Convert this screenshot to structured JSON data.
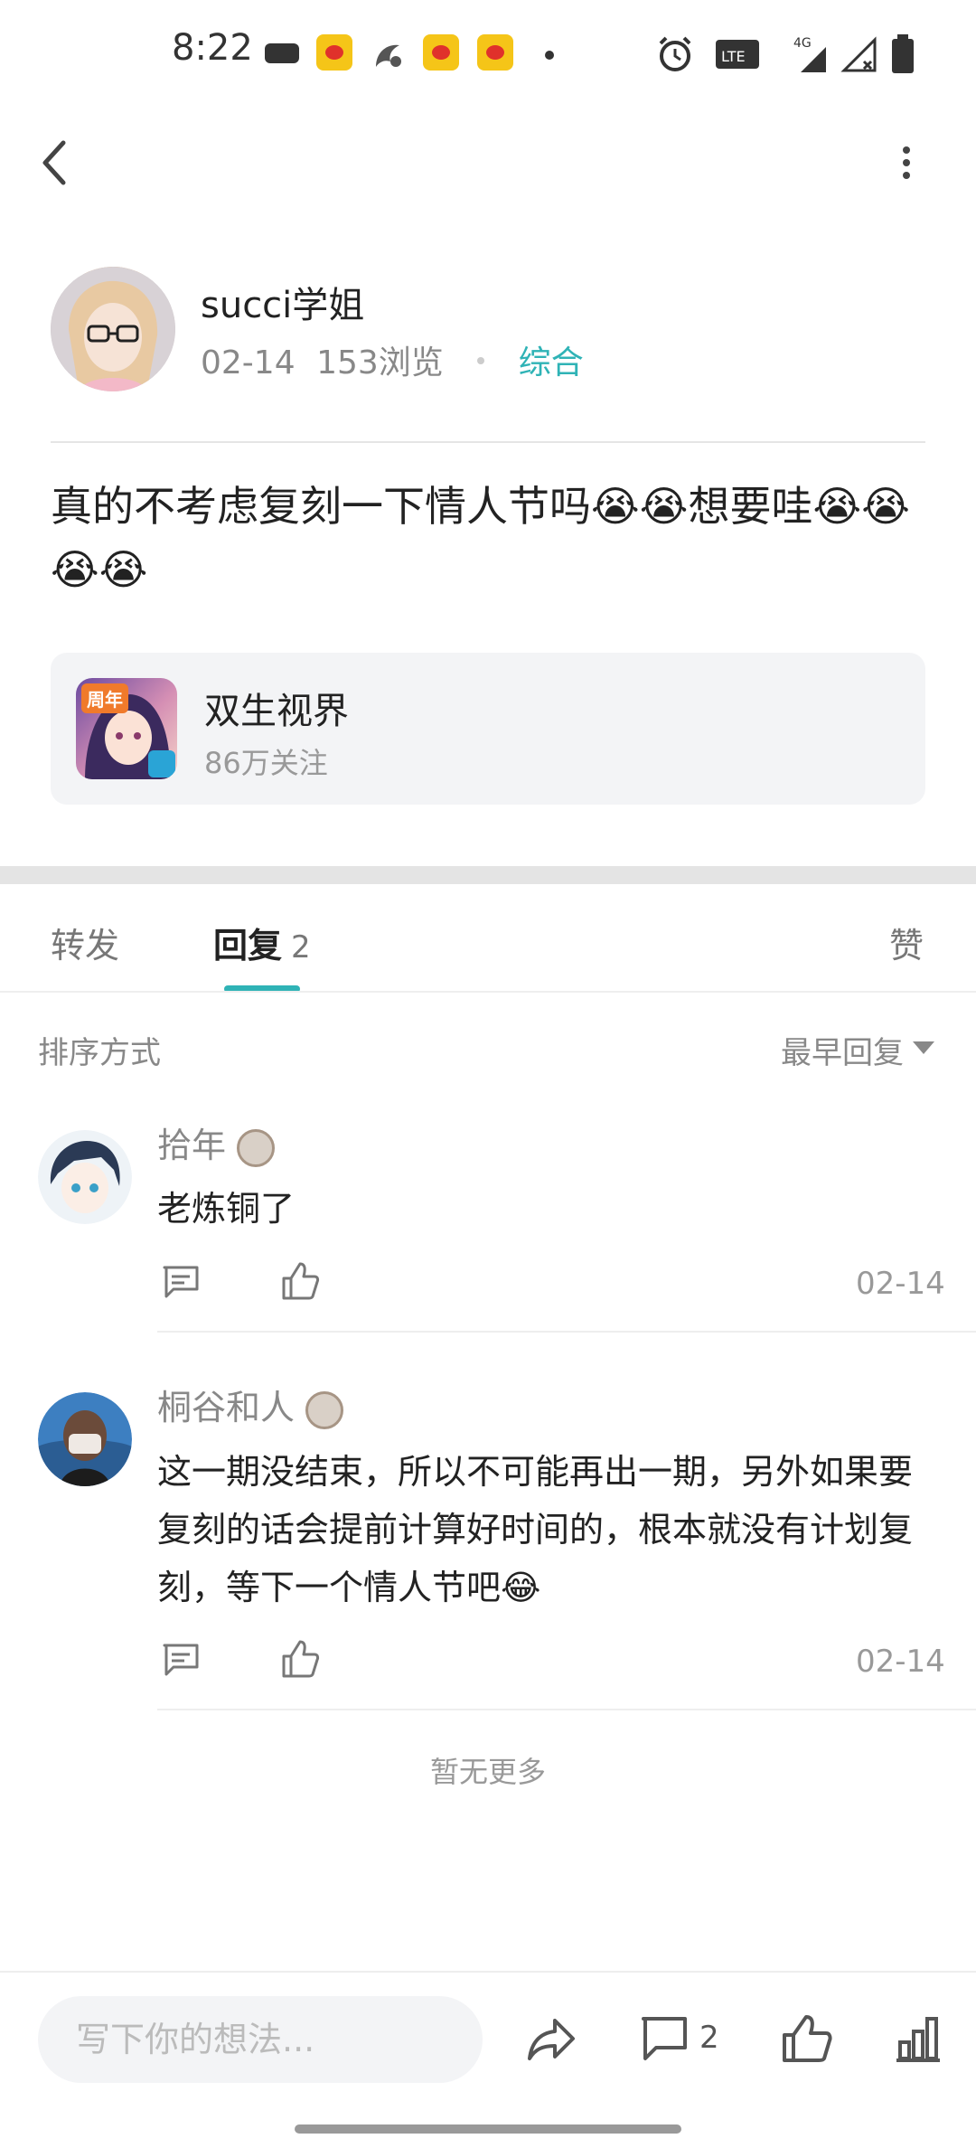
{
  "status_bar": {
    "time": "8:22",
    "icons": [
      "gamepad-icon",
      "weibo-icon",
      "uc-browser-icon",
      "weibo-icon",
      "weibo-icon",
      "dot-icon",
      "alarm-icon",
      "volte-icon",
      "signal-4g-icon",
      "signal-x-icon",
      "battery-icon"
    ],
    "signal_label": "4G"
  },
  "nav": {
    "back": "back-icon",
    "more": "more-icon"
  },
  "post": {
    "author": "succi学姐",
    "date": "02-14",
    "views": "153浏览",
    "category": "综合",
    "text": "真的不考虑复刻一下情人节吗😭😭想要哇😭😭😭😭"
  },
  "community": {
    "name": "双生视界",
    "followers": "86万关注",
    "icon_badge": "周年"
  },
  "tabs": [
    {
      "label": "转发",
      "count": ""
    },
    {
      "label": "回复",
      "count": "2"
    },
    {
      "label": "赞",
      "count": ""
    }
  ],
  "sort": {
    "label": "排序方式",
    "value": "最早回复"
  },
  "comments": [
    {
      "name": "拾年",
      "text": "老炼铜了",
      "date": "02-14"
    },
    {
      "name": "桐谷和人",
      "text": "这一期没结束，所以不可能再出一期，另外如果要复刻的话会提前计算好时间的，根本就没有计划复刻，等下一个情人节吧😂",
      "date": "02-14"
    }
  ],
  "no_more": "暂无更多",
  "bottom_bar": {
    "input_placeholder": "写下你的想法...",
    "comment_count": "2"
  },
  "colors": {
    "accent": "#2fb3b6",
    "muted": "#888888",
    "card_bg": "#f3f4f6"
  }
}
